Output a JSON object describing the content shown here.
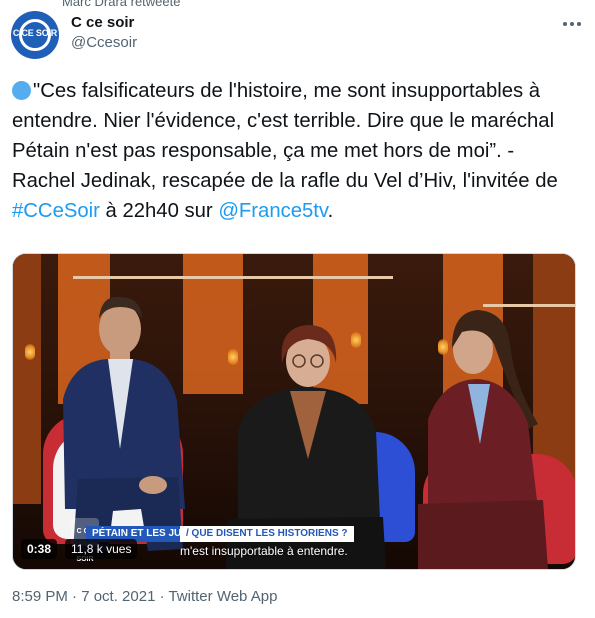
{
  "header": {
    "retweet_text": "Marc Drara retweeté",
    "display_name": "C ce soir",
    "handle": "@Ccesoir",
    "avatar_text": "C CE SOIR"
  },
  "tweet": {
    "emoji": "large-blue-circle",
    "text_part1": "\"Ces falsificateurs de l'histoire, me sont insupportables à entendre. Nier l'évidence, c'est terrible. Dire que le maréchal Pétain n'est pas responsable, ça me met hors de moi”. - Rachel Jedinak, rescapée de la rafle du Vel d’Hiv, l'invitée de ",
    "hashtag": "#CCeSoir",
    "text_part2": " à 22h40 sur ",
    "mention": "@France5tv",
    "text_part3": "."
  },
  "media": {
    "show_logo": "C CE SOIR",
    "topic_label": "PÉTAIN ET LES JUIFS",
    "topic_question": "/ QUE DISENT LES HISTORIENS ?",
    "subtitle": "m'est insupportable à entendre.",
    "time": "0:38",
    "views": "11,8 k vues"
  },
  "footer": {
    "meta": "8:59 PM · 7 oct. 2021 · Twitter Web App"
  },
  "colors": {
    "link": "#1d9bf0",
    "brand": "#1f5fb8",
    "banner": "#2358b8"
  }
}
